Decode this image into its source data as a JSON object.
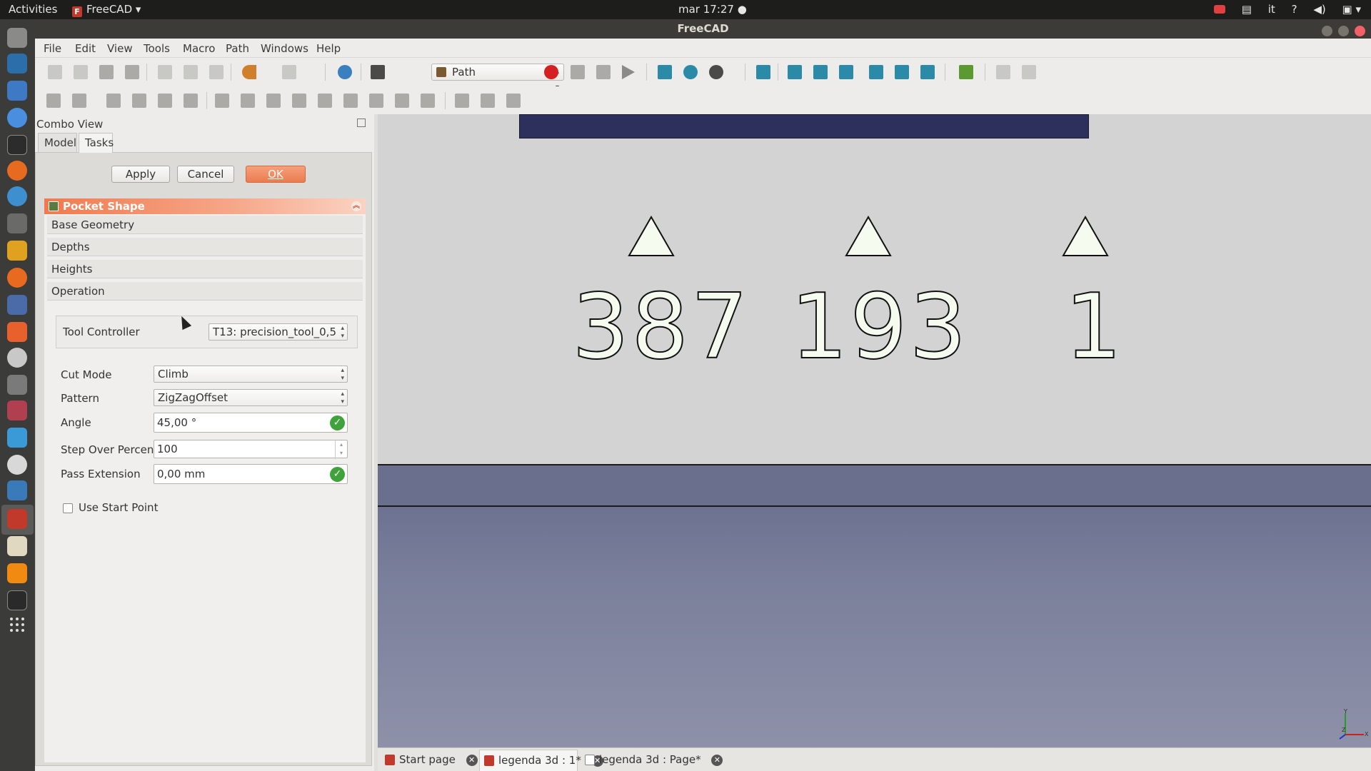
{
  "topbar": {
    "activities": "Activities",
    "app_name": "FreeCAD",
    "clock": "mar 17:27 ●",
    "keyboard_layout": "it",
    "help": "?"
  },
  "window": {
    "title": "FreeCAD"
  },
  "menu": {
    "items": [
      "File",
      "Edit",
      "View",
      "Tools",
      "Macro",
      "Path",
      "Windows",
      "Help"
    ]
  },
  "toolbar": {
    "workbench": "Path"
  },
  "combo_view": {
    "title": "Combo View",
    "tabs": [
      "Model",
      "Tasks"
    ],
    "active_tab": "Tasks",
    "buttons": {
      "apply": "Apply",
      "cancel": "Cancel",
      "ok": "OK"
    },
    "panel_title": "Pocket Shape",
    "sections": [
      "Base Geometry",
      "Depths",
      "Heights",
      "Operation"
    ],
    "tool_controller": {
      "label": "Tool Controller",
      "value": "T13: precision_tool_0,5"
    },
    "fields": {
      "cut_mode": {
        "label": "Cut Mode",
        "value": "Climb"
      },
      "pattern": {
        "label": "Pattern",
        "value": "ZigZagOffset"
      },
      "angle": {
        "label": "Angle",
        "value": "45,00 °"
      },
      "step_over": {
        "label": "Step Over Percent",
        "value": "100"
      },
      "pass_extension": {
        "label": "Pass Extension",
        "value": "0,00 mm"
      },
      "use_start_point": {
        "label": "Use Start Point",
        "checked": false
      }
    }
  },
  "view3d": {
    "numbers": [
      "387",
      "193",
      "1"
    ],
    "axis_labels": {
      "x": "X",
      "y": "Y",
      "z": "Z"
    }
  },
  "doc_tabs": [
    {
      "label": "Start page",
      "active": false
    },
    {
      "label": "legenda 3d : 1*",
      "active": true
    },
    {
      "label": "legenda 3d : Page*",
      "active": false
    }
  ],
  "colors": {
    "accent_orange": "#ea7c50",
    "dark_bar": "#2d2f5c",
    "floor": "#7a7f9b",
    "ok_green": "#3fa23a"
  }
}
